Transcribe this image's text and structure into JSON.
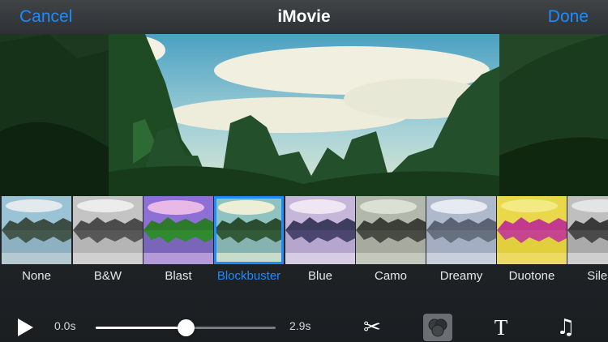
{
  "nav": {
    "cancel_label": "Cancel",
    "title": "iMovie",
    "done_label": "Done"
  },
  "filters": [
    {
      "label": "None",
      "selected": false
    },
    {
      "label": "B&W",
      "selected": false
    },
    {
      "label": "Blast",
      "selected": false
    },
    {
      "label": "Blockbuster",
      "selected": true
    },
    {
      "label": "Blue",
      "selected": false
    },
    {
      "label": "Camo",
      "selected": false
    },
    {
      "label": "Dreamy",
      "selected": false
    },
    {
      "label": "Duotone",
      "selected": false
    },
    {
      "label": "Silent",
      "selected": false
    }
  ],
  "player": {
    "start_time": "0.0s",
    "end_time": "2.9s",
    "progress_fraction": 0.5
  },
  "tools": [
    "scissors-icon",
    "filters-icon",
    "title-icon",
    "music-icon"
  ],
  "colors": {
    "accent": "#1a8cff"
  }
}
